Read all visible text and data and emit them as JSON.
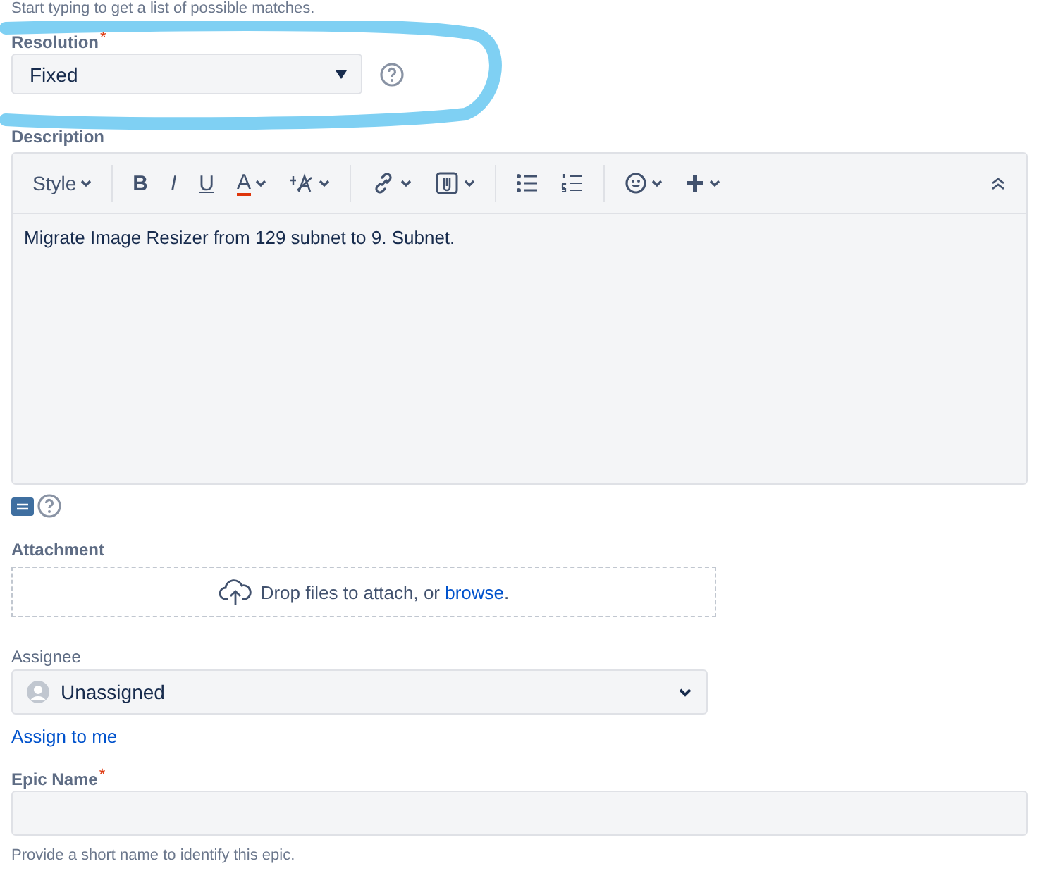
{
  "top_hint": "Start typing to get a list of possible matches.",
  "resolution": {
    "label": "Resolution",
    "required_mark": "*",
    "value": "Fixed"
  },
  "description": {
    "label": "Description",
    "toolbar": [
      {
        "kind": "style",
        "label": "Style"
      },
      {
        "kind": "divider"
      },
      {
        "kind": "bold",
        "label": "B"
      },
      {
        "kind": "italic",
        "label": "I"
      },
      {
        "kind": "underline",
        "label": "U"
      },
      {
        "kind": "color",
        "label": "A",
        "color": "#de350b"
      },
      {
        "kind": "textsize"
      },
      {
        "kind": "divider"
      },
      {
        "kind": "link"
      },
      {
        "kind": "attach"
      },
      {
        "kind": "divider"
      },
      {
        "kind": "bullets"
      },
      {
        "kind": "numbers"
      },
      {
        "kind": "divider"
      },
      {
        "kind": "emoji"
      },
      {
        "kind": "insert"
      }
    ],
    "value": "Migrate Image Resizer from 129 subnet to 9. Subnet."
  },
  "attachment": {
    "label": "Attachment",
    "text": "Drop files to attach, or ",
    "link": "browse",
    "after": "."
  },
  "assignee": {
    "label": "Assignee",
    "value": "Unassigned",
    "assign_link": "Assign to me"
  },
  "epic_name": {
    "label": "Epic Name",
    "required_mark": "*",
    "help": "Provide a short name to identify this epic."
  }
}
